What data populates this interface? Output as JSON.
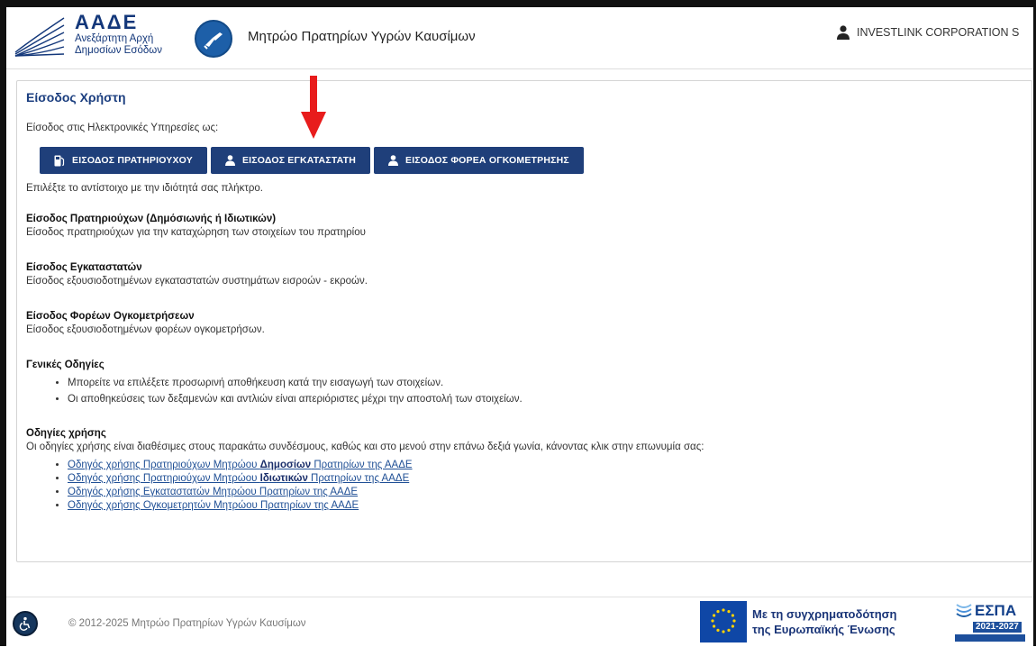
{
  "header": {
    "logo_name": "ΑΑΔΕ",
    "logo_sub_line1": "Ανεξάρτητη Αρχή",
    "logo_sub_line2": "Δημοσίων Εσόδων",
    "app_title": "Μητρώο Πρατηρίων Υγρών Καυσίμων",
    "user_name": "INVESTLINK CORPORATION S"
  },
  "main": {
    "title": "Είσοδος Χρήστη",
    "intro": "Είσοδος στις Ηλεκτρονικές Υπηρεσίες ως:",
    "buttons": [
      {
        "label": "ΕΙΣΟΔΟΣ ΠΡΑΤΗΡΙΟΥΧΟΥ",
        "icon": "fuel-pump-icon"
      },
      {
        "label": "ΕΙΣΟΔΟΣ ΕΓΚΑΤΑΣΤΑΤΗ",
        "icon": "user-icon"
      },
      {
        "label": "ΕΙΣΟΔΟΣ ΦΟΡΕΑ ΟΓΚΟΜΕΤΡΗΣΗΣ",
        "icon": "user-icon"
      }
    ],
    "hint": "Επιλέξτε το αντίστοιχο με την ιδιότητά σας πλήκτρο.",
    "sections": [
      {
        "title": "Είσοδος Πρατηριούχων (Δημόσιωνής ή Ιδιωτικών)",
        "text": "Είσοδος πρατηριούχων για την καταχώρηση των στοιχείων του πρατηρίου"
      },
      {
        "title": "Είσοδος Εγκαταστατών",
        "text": "Είσοδος εξουσιοδοτημένων εγκαταστατών συστημάτων εισροών - εκροών."
      },
      {
        "title": "Είσοδος Φορέων Ογκομετρήσεων",
        "text": "Είσοδος εξουσιοδοτημένων φορέων ογκομετρήσων."
      }
    ],
    "general": {
      "title": "Γενικές Οδηγίες",
      "items": [
        "Μπορείτε να επιλέξετε προσωρινή αποθήκευση κατά την εισαγωγή των στοιχείων.",
        "Οι αποθηκεύσεις των δεξαμενών και αντλιών είναι απεριόριστες μέχρι την αποστολή των στοιχείων."
      ]
    },
    "usage": {
      "title": "Οδηγίες χρήσης",
      "text": "Οι οδηγίες χρήσης είναι διαθέσιμες στους παρακάτω συνδέσμους, καθώς και στο μενού στην επάνω δεξιά γωνία, κάνοντας κλικ στην επωνυμία σας:",
      "links": [
        {
          "pre": "Οδηγός χρήσης Πρατηριούχων Μητρώου ",
          "bold": "Δημοσίων",
          "post": " Πρατηρίων της ΑΑΔΕ"
        },
        {
          "pre": "Οδηγός χρήσης Πρατηριούχων Μητρώου ",
          "bold": "Ιδιωτικών",
          "post": " Πρατηρίων της ΑΑΔΕ"
        },
        {
          "pre": "Οδηγός χρήσης Εγκαταστατών Μητρώου Πρατηρίων της ΑΑΔΕ",
          "bold": "",
          "post": ""
        },
        {
          "pre": "Οδηγός χρήσης Ογκομετρητών Μητρώου Πρατηρίων της ΑΑΔΕ",
          "bold": "",
          "post": ""
        }
      ]
    }
  },
  "footer": {
    "copyright": "© 2012-2025 Μητρώο Πρατηρίων Υγρών Καυσίμων",
    "eu_line1": "Με τη συγχρηματοδότηση",
    "eu_line2": "της Ευρωπαϊκής Ένωσης",
    "espa_title": "ΕΣΠΑ",
    "espa_years": "2021-2027"
  },
  "colors": {
    "primary": "#1f3f7a",
    "link": "#1f4f95",
    "annotation_arrow": "#e81c1c"
  }
}
